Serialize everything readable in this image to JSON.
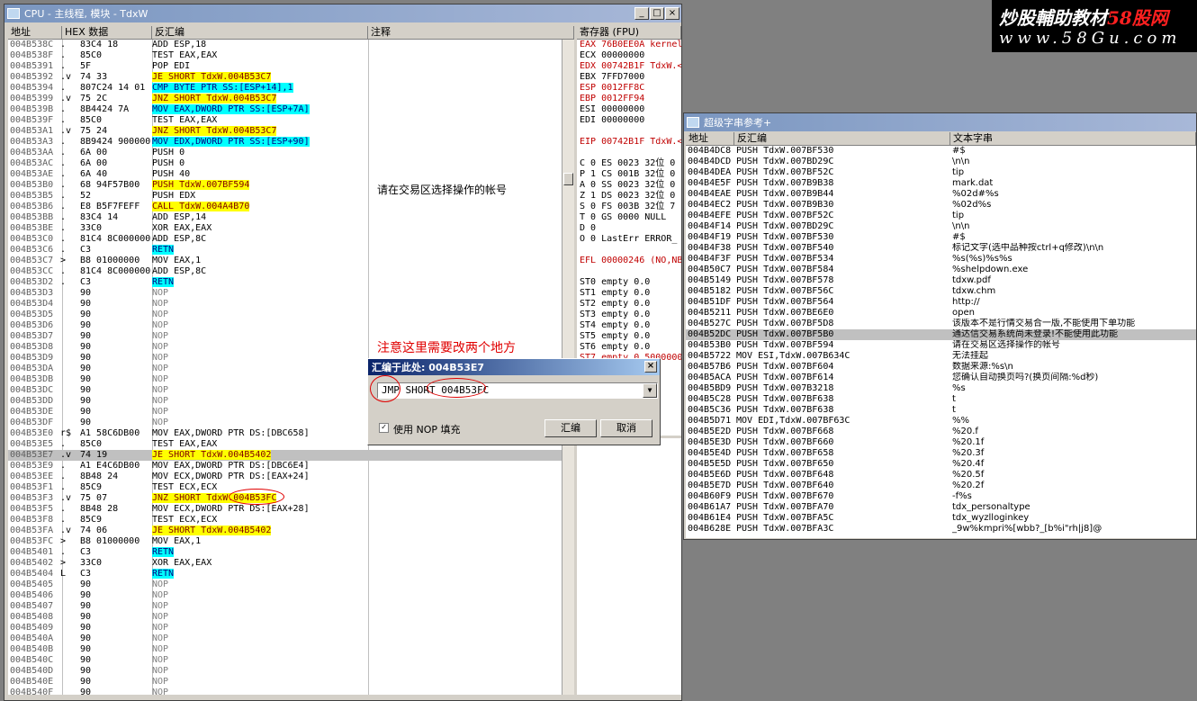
{
  "cpu": {
    "title": "CPU - 主线程, 模块 - TdxW",
    "headers": [
      "地址",
      "HEX 数据",
      "反汇编",
      "注释"
    ],
    "rows": [
      {
        "a": "004B538C",
        "r": ".",
        "h": "83C4 18",
        "d": "ADD ESP,18"
      },
      {
        "a": "004B538F",
        "r": ".",
        "h": "85C0",
        "d": "TEST EAX,EAX"
      },
      {
        "a": "004B5391",
        "r": ".",
        "h": "5F",
        "d": "POP EDI"
      },
      {
        "a": "004B5392",
        "r": ".v",
        "h": "74 33",
        "d": "JE SHORT TdxW.004B53C7",
        "hl": "y"
      },
      {
        "a": "004B5394",
        "r": ".",
        "h": "807C24 14 01",
        "d": "CMP BYTE PTR SS:[ESP+14],1",
        "hl": "c"
      },
      {
        "a": "004B5399",
        "r": ".v",
        "h": "75 2C",
        "d": "JNZ SHORT TdxW.004B53C7",
        "hl": "y"
      },
      {
        "a": "004B539B",
        "r": ".",
        "h": "8B4424 7A",
        "d": "MOV EAX,DWORD PTR SS:[ESP+7A]",
        "hl": "c"
      },
      {
        "a": "004B539F",
        "r": ".",
        "h": "85C0",
        "d": "TEST EAX,EAX"
      },
      {
        "a": "004B53A1",
        "r": ".v",
        "h": "75 24",
        "d": "JNZ SHORT TdxW.004B53C7",
        "hl": "y"
      },
      {
        "a": "004B53A3",
        "r": ".",
        "h": "8B9424 900000",
        "d": "MOV EDX,DWORD PTR SS:[ESP+90]",
        "hl": "c"
      },
      {
        "a": "004B53AA",
        "r": ".",
        "h": "6A 00",
        "d": "PUSH 0"
      },
      {
        "a": "004B53AC",
        "r": ".",
        "h": "6A 00",
        "d": "PUSH 0"
      },
      {
        "a": "004B53AE",
        "r": ".",
        "h": "6A 40",
        "d": "PUSH 40"
      },
      {
        "a": "004B53B0",
        "r": ".",
        "h": "68 94F57B00",
        "d": "PUSH TdxW.007BF594",
        "hl": "y"
      },
      {
        "a": "004B53B5",
        "r": ".",
        "h": "52",
        "d": "PUSH EDX"
      },
      {
        "a": "004B53B6",
        "r": ".",
        "h": "E8 B5F7FEFF",
        "d": "CALL TdxW.004A4B70",
        "hl": "y"
      },
      {
        "a": "004B53BB",
        "r": ".",
        "h": "83C4 14",
        "d": "ADD ESP,14"
      },
      {
        "a": "004B53BE",
        "r": ".",
        "h": "33C0",
        "d": "XOR EAX,EAX"
      },
      {
        "a": "004B53C0",
        "r": ".",
        "h": "81C4 8C000000",
        "d": "ADD ESP,8C"
      },
      {
        "a": "004B53C6",
        "r": ".",
        "h": "C3",
        "d": "RETN",
        "hl": "c"
      },
      {
        "a": "004B53C7",
        "r": ">",
        "h": "B8 01000000",
        "d": "MOV EAX,1"
      },
      {
        "a": "004B53CC",
        "r": ".",
        "h": "81C4 8C000000",
        "d": "ADD ESP,8C"
      },
      {
        "a": "004B53D2",
        "r": ".",
        "h": "C3",
        "d": "RETN",
        "hl": "c"
      },
      {
        "a": "004B53D3",
        "r": "",
        "h": "90",
        "d": "NOP",
        "hl": "n"
      },
      {
        "a": "004B53D4",
        "r": "",
        "h": "90",
        "d": "NOP",
        "hl": "n"
      },
      {
        "a": "004B53D5",
        "r": "",
        "h": "90",
        "d": "NOP",
        "hl": "n"
      },
      {
        "a": "004B53D6",
        "r": "",
        "h": "90",
        "d": "NOP",
        "hl": "n"
      },
      {
        "a": "004B53D7",
        "r": "",
        "h": "90",
        "d": "NOP",
        "hl": "n"
      },
      {
        "a": "004B53D8",
        "r": "",
        "h": "90",
        "d": "NOP",
        "hl": "n"
      },
      {
        "a": "004B53D9",
        "r": "",
        "h": "90",
        "d": "NOP",
        "hl": "n"
      },
      {
        "a": "004B53DA",
        "r": "",
        "h": "90",
        "d": "NOP",
        "hl": "n"
      },
      {
        "a": "004B53DB",
        "r": "",
        "h": "90",
        "d": "NOP",
        "hl": "n"
      },
      {
        "a": "004B53DC",
        "r": "",
        "h": "90",
        "d": "NOP",
        "hl": "n"
      },
      {
        "a": "004B53DD",
        "r": "",
        "h": "90",
        "d": "NOP",
        "hl": "n"
      },
      {
        "a": "004B53DE",
        "r": "",
        "h": "90",
        "d": "NOP",
        "hl": "n"
      },
      {
        "a": "004B53DF",
        "r": "",
        "h": "90",
        "d": "NOP",
        "hl": "n"
      },
      {
        "a": "004B53E0",
        "r": "r$",
        "h": "A1 58C6DB00",
        "d": "MOV EAX,DWORD PTR DS:[DBC658]"
      },
      {
        "a": "004B53E5",
        "r": ".",
        "h": "85C0",
        "d": "TEST EAX,EAX"
      },
      {
        "a": "004B53E7",
        "r": ".v",
        "h": "74 19",
        "d": "JE SHORT TdxW.004B5402",
        "hl": "y",
        "sel": true
      },
      {
        "a": "004B53E9",
        "r": ".",
        "h": "A1 E4C6DB00",
        "d": "MOV EAX,DWORD PTR DS:[DBC6E4]"
      },
      {
        "a": "004B53EE",
        "r": ".",
        "h": "8B48 24",
        "d": "MOV ECX,DWORD PTR DS:[EAX+24]"
      },
      {
        "a": "004B53F1",
        "r": ".",
        "h": "85C9",
        "d": "TEST ECX,ECX"
      },
      {
        "a": "004B53F3",
        "r": ".v",
        "h": "75 07",
        "d": "JNZ SHORT TdxW.004B53FC",
        "hl": "y"
      },
      {
        "a": "004B53F5",
        "r": ".",
        "h": "8B48 28",
        "d": "MOV ECX,DWORD PTR DS:[EAX+28]"
      },
      {
        "a": "004B53F8",
        "r": ".",
        "h": "85C9",
        "d": "TEST ECX,ECX"
      },
      {
        "a": "004B53FA",
        "r": ".v",
        "h": "74 06",
        "d": "JE SHORT TdxW.004B5402",
        "hl": "y"
      },
      {
        "a": "004B53FC",
        "r": ">",
        "h": "B8 01000000",
        "d": "MOV EAX,1"
      },
      {
        "a": "004B5401",
        "r": ".",
        "h": "C3",
        "d": "RETN",
        "hl": "c"
      },
      {
        "a": "004B5402",
        "r": ">",
        "h": "33C0",
        "d": "XOR EAX,EAX"
      },
      {
        "a": "004B5404",
        "r": "L",
        "h": "C3",
        "d": "RETN",
        "hl": "c"
      },
      {
        "a": "004B5405",
        "r": "",
        "h": "90",
        "d": "NOP",
        "hl": "n"
      },
      {
        "a": "004B5406",
        "r": "",
        "h": "90",
        "d": "NOP",
        "hl": "n"
      },
      {
        "a": "004B5407",
        "r": "",
        "h": "90",
        "d": "NOP",
        "hl": "n"
      },
      {
        "a": "004B5408",
        "r": "",
        "h": "90",
        "d": "NOP",
        "hl": "n"
      },
      {
        "a": "004B5409",
        "r": "",
        "h": "90",
        "d": "NOP",
        "hl": "n"
      },
      {
        "a": "004B540A",
        "r": "",
        "h": "90",
        "d": "NOP",
        "hl": "n"
      },
      {
        "a": "004B540B",
        "r": "",
        "h": "90",
        "d": "NOP",
        "hl": "n"
      },
      {
        "a": "004B540C",
        "r": "",
        "h": "90",
        "d": "NOP",
        "hl": "n"
      },
      {
        "a": "004B540D",
        "r": "",
        "h": "90",
        "d": "NOP",
        "hl": "n"
      },
      {
        "a": "004B540E",
        "r": "",
        "h": "90",
        "d": "NOP",
        "hl": "n"
      },
      {
        "a": "004B540F",
        "r": "",
        "h": "90",
        "d": "NOP",
        "hl": "n"
      }
    ],
    "comment_text": "请在交易区选择操作的帐号",
    "note_text": "注意这里需要改两个地方"
  },
  "registers": {
    "header": "寄存器 (FPU)",
    "lines": [
      {
        "t": "EAX 76B0EE0A kernel",
        "red": true
      },
      {
        "t": "ECX 00000000"
      },
      {
        "t": "EDX 00742B1F TdxW.<",
        "red": true
      },
      {
        "t": "EBX 7FFD7000"
      },
      {
        "t": "ESP 0012FF8C",
        "red": true
      },
      {
        "t": "EBP 0012FF94",
        "red": true
      },
      {
        "t": "ESI 00000000"
      },
      {
        "t": "EDI 00000000"
      },
      {
        "t": ""
      },
      {
        "t": "EIP 00742B1F TdxW.<",
        "red": true
      },
      {
        "t": ""
      },
      {
        "t": "C 0  ES 0023 32位 0"
      },
      {
        "t": "P 1  CS 001B 32位 0"
      },
      {
        "t": "A 0  SS 0023 32位 0"
      },
      {
        "t": "Z 1  DS 0023 32位 0"
      },
      {
        "t": "S 0  FS 003B 32位 7"
      },
      {
        "t": "T 0  GS 0000 NULL"
      },
      {
        "t": "D 0"
      },
      {
        "t": "O 0  LastErr ERROR_"
      },
      {
        "t": ""
      },
      {
        "t": "EFL 00000246 (NO,NB",
        "red": true
      },
      {
        "t": ""
      },
      {
        "t": "ST0 empty 0.0"
      },
      {
        "t": "ST1 empty 0.0"
      },
      {
        "t": "ST2 empty 0.0"
      },
      {
        "t": "ST3 empty 0.0"
      },
      {
        "t": "ST4 empty 0.0"
      },
      {
        "t": "ST5 empty 0.0"
      },
      {
        "t": "ST6 empty 0.0"
      },
      {
        "t": "ST7 empty 0.5000000",
        "red": true
      },
      {
        "t": "               3 2"
      }
    ]
  },
  "ad": {
    "line1_a": "炒股輔助教材",
    "line1_b": "58股网",
    "line2": "www.58Gu.com"
  },
  "strings": {
    "title": "超级字串参考+",
    "headers": [
      "地址",
      "反汇编",
      "文本字串"
    ],
    "rows": [
      {
        "a": "004B4DC8",
        "d": "PUSH TdxW.007BF530",
        "t": "#$"
      },
      {
        "a": "004B4DCD",
        "d": "PUSH TdxW.007BD29C",
        "t": "\\n\\n"
      },
      {
        "a": "004B4DEA",
        "d": "PUSH TdxW.007BF52C",
        "t": "tip"
      },
      {
        "a": "004B4E5F",
        "d": "PUSH TdxW.007B9B38",
        "t": "mark.dat"
      },
      {
        "a": "004B4EAE",
        "d": "PUSH TdxW.007B9B44",
        "t": "%02d#%s"
      },
      {
        "a": "004B4EC2",
        "d": "PUSH TdxW.007B9B30",
        "t": "%02d%s"
      },
      {
        "a": "004B4EFE",
        "d": "PUSH TdxW.007BF52C",
        "t": "tip"
      },
      {
        "a": "004B4F14",
        "d": "PUSH TdxW.007BD29C",
        "t": "\\n\\n"
      },
      {
        "a": "004B4F19",
        "d": "PUSH TdxW.007BF530",
        "t": "#$"
      },
      {
        "a": "004B4F38",
        "d": "PUSH TdxW.007BF540",
        "t": "标记文字(选中品种按ctrl+q修改)\\n\\n"
      },
      {
        "a": "004B4F3F",
        "d": "PUSH TdxW.007BF534",
        "t": "%s(%s)%s%s"
      },
      {
        "a": "004B50C7",
        "d": "PUSH TdxW.007BF584",
        "t": "%shelpdown.exe"
      },
      {
        "a": "004B5149",
        "d": "PUSH TdxW.007BF578",
        "t": "tdxw.pdf"
      },
      {
        "a": "004B5182",
        "d": "PUSH TdxW.007BF56C",
        "t": "tdxw.chm"
      },
      {
        "a": "004B51DF",
        "d": "PUSH TdxW.007BF564",
        "t": "http://"
      },
      {
        "a": "004B5211",
        "d": "PUSH TdxW.007BE6E0",
        "t": "open"
      },
      {
        "a": "004B527C",
        "d": "PUSH TdxW.007BF5D8",
        "t": "该版本不是行情交易合一版,不能使用下单功能"
      },
      {
        "a": "004B52DC",
        "d": "PUSH TdxW.007BF5B0",
        "t": "通达信交易系统尚未登录!不能使用此功能",
        "sel": true
      },
      {
        "a": "004B53B0",
        "d": "PUSH TdxW.007BF594",
        "t": "请在交易区选择操作的帐号"
      },
      {
        "a": "004B5722",
        "d": "MOV ESI,TdxW.007B634C",
        "t": "无法挂起"
      },
      {
        "a": "004B57B6",
        "d": "PUSH TdxW.007BF604",
        "t": "数据来源:%s\\n"
      },
      {
        "a": "004B5ACA",
        "d": "PUSH TdxW.007BF614",
        "t": "您确认自动换页吗?(换页间隔:%d秒)"
      },
      {
        "a": "004B5BD9",
        "d": "PUSH TdxW.007B3218",
        "t": "%s"
      },
      {
        "a": "004B5C28",
        "d": "PUSH TdxW.007BF638",
        "t": "t"
      },
      {
        "a": "004B5C36",
        "d": "PUSH TdxW.007BF638",
        "t": "t"
      },
      {
        "a": "004B5D71",
        "d": "MOV EDI,TdxW.007BF63C",
        "t": "%%"
      },
      {
        "a": "004B5E2D",
        "d": "PUSH TdxW.007BF668",
        "t": "%20.f"
      },
      {
        "a": "004B5E3D",
        "d": "PUSH TdxW.007BF660",
        "t": "%20.1f"
      },
      {
        "a": "004B5E4D",
        "d": "PUSH TdxW.007BF658",
        "t": "%20.3f"
      },
      {
        "a": "004B5E5D",
        "d": "PUSH TdxW.007BF650",
        "t": "%20.4f"
      },
      {
        "a": "004B5E6D",
        "d": "PUSH TdxW.007BF648",
        "t": "%20.5f"
      },
      {
        "a": "004B5E7D",
        "d": "PUSH TdxW.007BF640",
        "t": "%20.2f"
      },
      {
        "a": "004B60F9",
        "d": "PUSH TdxW.007BF670",
        "t": "-f%s"
      },
      {
        "a": "004B61A7",
        "d": "PUSH TdxW.007BFA70",
        "t": "tdx_personaltype"
      },
      {
        "a": "004B61E4",
        "d": "PUSH TdxW.007BFA5C",
        "t": "tdx_wyzlloginkey"
      },
      {
        "a": "004B628E",
        "d": "PUSH TdxW.007BFA3C",
        "t": "_9w%kmpri%[wbb?_[b%i\"rh|j8]@"
      }
    ]
  },
  "dialog": {
    "title": "汇编于此处: 004B53E7",
    "value": "JMP SHORT 004B53FC",
    "checkbox_label": "使用 NOP 填充",
    "assemble_label": "汇编",
    "cancel_label": "取消"
  }
}
